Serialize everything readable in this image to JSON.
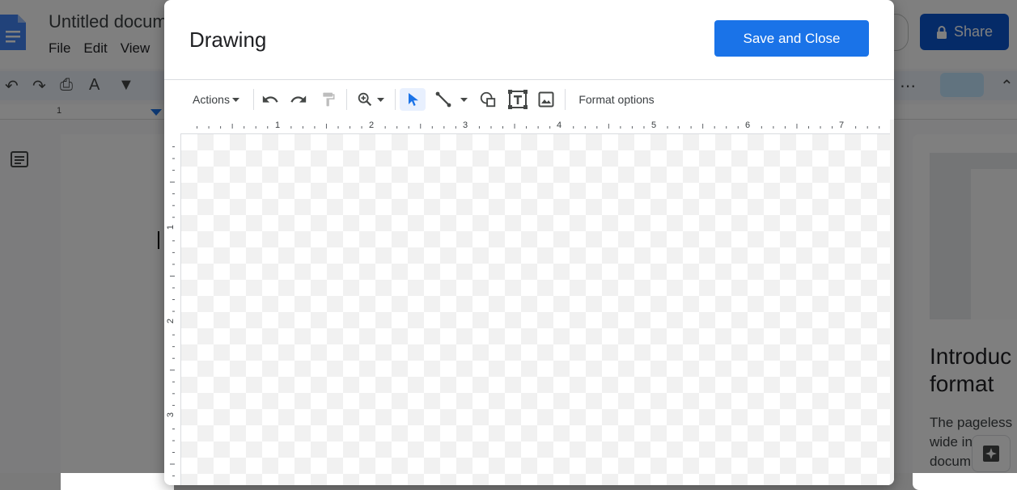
{
  "background": {
    "doc_title": "Untitled docum",
    "menu": [
      "File",
      "Edit",
      "View"
    ],
    "share_label": "Share",
    "ruler_label": "1",
    "side_heading_line1": "Introduc",
    "side_heading_line2": "format",
    "side_text_line1": "The pageless",
    "side_text_line2": "wide in",
    "side_text_line3": "docum"
  },
  "dialog": {
    "title": "Drawing",
    "save_close_label": "Save and Close",
    "toolbar": {
      "actions_label": "Actions",
      "format_options_label": "Format options",
      "icons": [
        "undo-icon",
        "redo-icon",
        "paint-format-icon",
        "zoom-icon",
        "select-icon",
        "line-icon",
        "shape-icon",
        "text-box-icon",
        "image-icon"
      ]
    },
    "ruler_h": [
      "1",
      "2",
      "3",
      "4",
      "5",
      "6",
      "7"
    ],
    "ruler_v": [
      "1",
      "2",
      "3"
    ]
  },
  "colors": {
    "primary": "#1a73e8",
    "share": "#0b57d0",
    "select_active": "#e8f0fe"
  }
}
